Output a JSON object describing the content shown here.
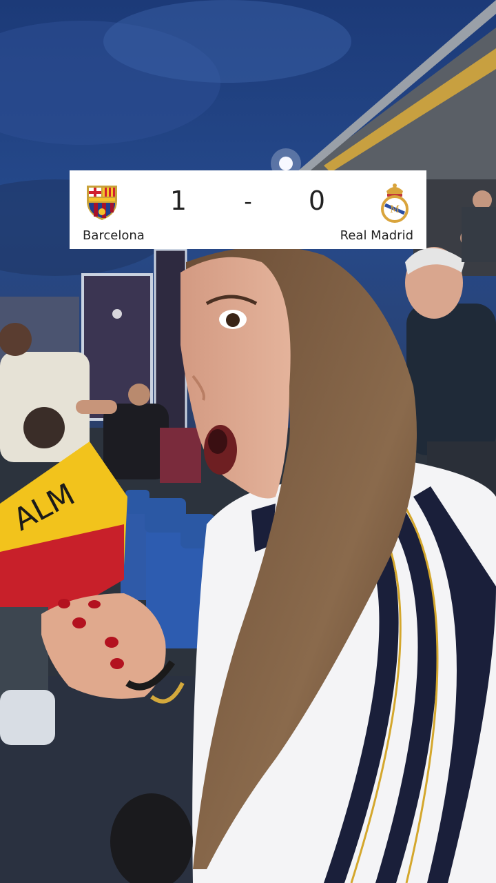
{
  "scoreboard": {
    "home_team": "Barcelona",
    "away_team": "Real Madrid",
    "home_score": "1",
    "separator": "-",
    "away_score": "0",
    "home_crest_icon": "barcelona-crest-icon",
    "away_crest_icon": "real-madrid-crest-icon"
  },
  "flag_text": "ALM"
}
